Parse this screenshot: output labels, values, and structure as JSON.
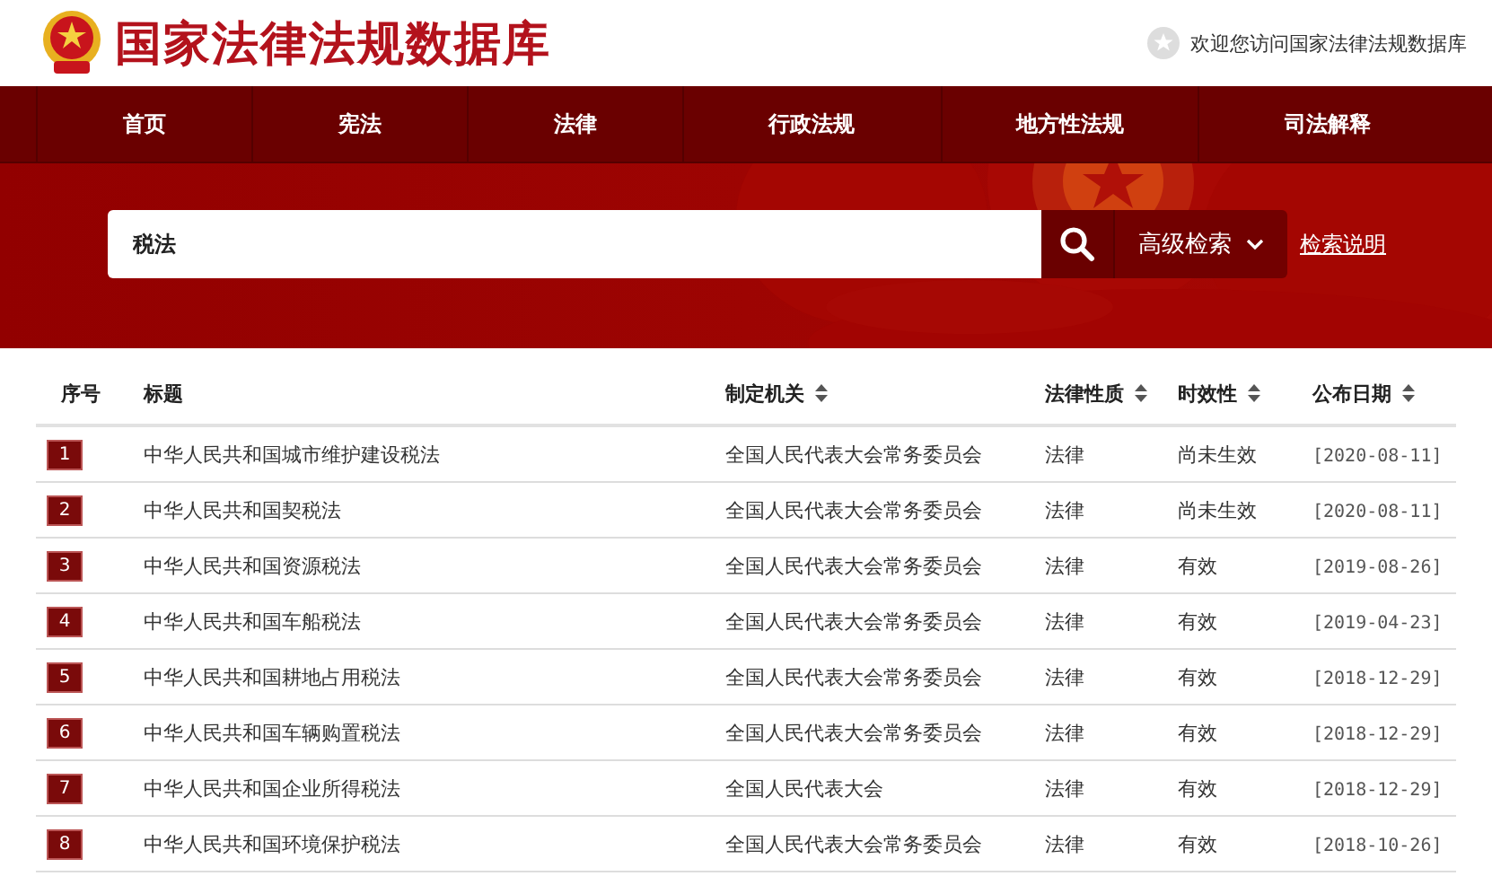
{
  "header": {
    "title": "国家法律法规数据库",
    "welcome": "欢迎您访问国家法律法规数据库"
  },
  "nav": [
    "首页",
    "宪法",
    "法律",
    "行政法规",
    "地方性法规",
    "司法解释"
  ],
  "search": {
    "value": "税法",
    "advanced": "高级检索",
    "help_link": "检索说明"
  },
  "table": {
    "columns": [
      {
        "label": "序号",
        "sortable": false
      },
      {
        "label": "标题",
        "sortable": false
      },
      {
        "label": "制定机关",
        "sortable": true
      },
      {
        "label": "法律性质",
        "sortable": true
      },
      {
        "label": "时效性",
        "sortable": true
      },
      {
        "label": "公布日期",
        "sortable": true
      }
    ],
    "rows": [
      {
        "index": "1",
        "title": "中华人民共和国城市维护建设税法",
        "authority": "全国人民代表大会常务委员会",
        "nature": "法律",
        "validity": "尚未生效",
        "date": "[2020-08-11]"
      },
      {
        "index": "2",
        "title": "中华人民共和国契税法",
        "authority": "全国人民代表大会常务委员会",
        "nature": "法律",
        "validity": "尚未生效",
        "date": "[2020-08-11]"
      },
      {
        "index": "3",
        "title": "中华人民共和国资源税法",
        "authority": "全国人民代表大会常务委员会",
        "nature": "法律",
        "validity": "有效",
        "date": "[2019-08-26]"
      },
      {
        "index": "4",
        "title": "中华人民共和国车船税法",
        "authority": "全国人民代表大会常务委员会",
        "nature": "法律",
        "validity": "有效",
        "date": "[2019-04-23]"
      },
      {
        "index": "5",
        "title": "中华人民共和国耕地占用税法",
        "authority": "全国人民代表大会常务委员会",
        "nature": "法律",
        "validity": "有效",
        "date": "[2018-12-29]"
      },
      {
        "index": "6",
        "title": "中华人民共和国车辆购置税法",
        "authority": "全国人民代表大会常务委员会",
        "nature": "法律",
        "validity": "有效",
        "date": "[2018-12-29]"
      },
      {
        "index": "7",
        "title": "中华人民共和国企业所得税法",
        "authority": "全国人民代表大会",
        "nature": "法律",
        "validity": "有效",
        "date": "[2018-12-29]"
      },
      {
        "index": "8",
        "title": "中华人民共和国环境保护税法",
        "authority": "全国人民代表大会常务委员会",
        "nature": "法律",
        "validity": "有效",
        "date": "[2018-10-26]"
      }
    ]
  }
}
